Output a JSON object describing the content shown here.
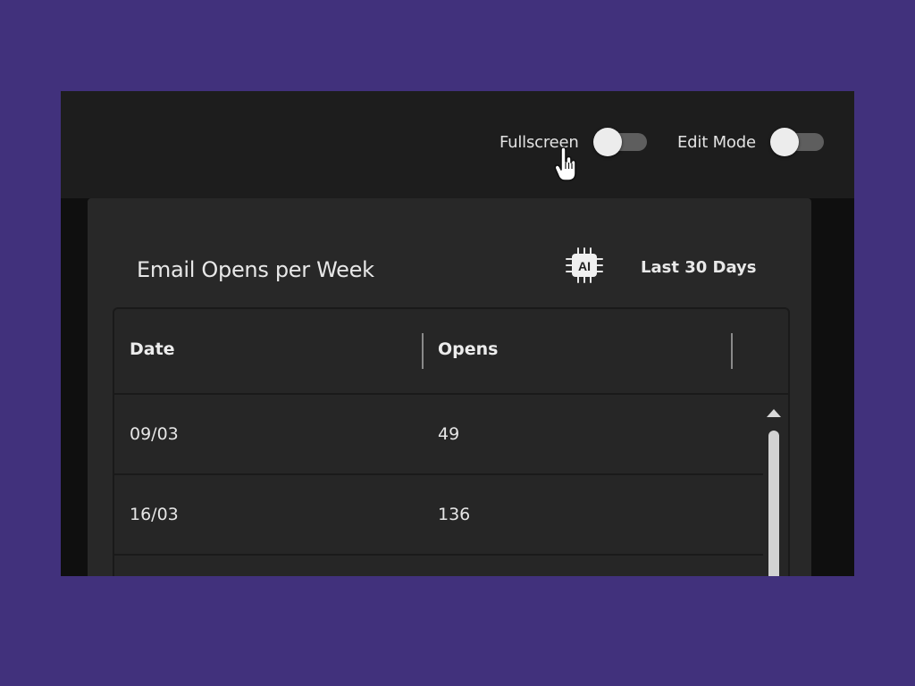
{
  "toolbar": {
    "fullscreen": {
      "label": "Fullscreen",
      "on": false
    },
    "edit_mode": {
      "label": "Edit Mode",
      "on": false
    }
  },
  "widget": {
    "title": "Email Opens per Week",
    "ai_badge": "AI",
    "ai_icon": "ai-chip-icon",
    "range": "Last 30 Days"
  },
  "table": {
    "columns": [
      "Date",
      "Opens"
    ],
    "rows": [
      {
        "date": "09/03",
        "opens": "49"
      },
      {
        "date": "16/03",
        "opens": "136"
      }
    ]
  },
  "colors": {
    "backdrop": "#41317c",
    "window": "#0f0f0f",
    "topbar": "#1d1d1d",
    "panel": "#282828",
    "text": "#e8e8e8",
    "toggle_track": "#5e5e5e",
    "toggle_knob": "#ececec"
  }
}
